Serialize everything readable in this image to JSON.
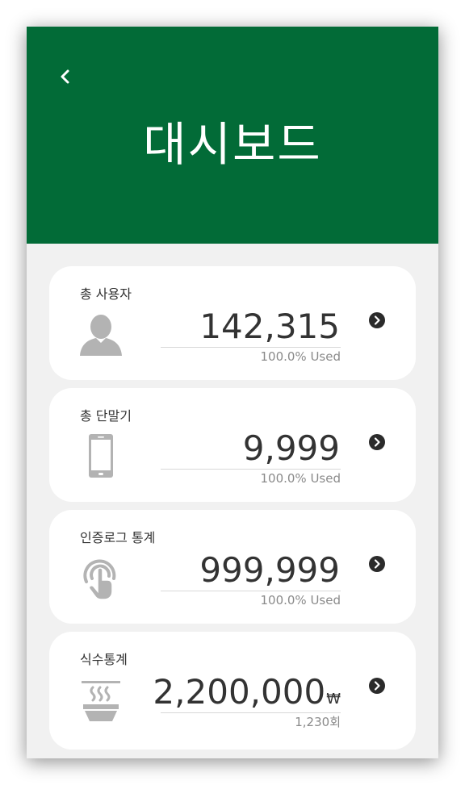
{
  "header": {
    "title": "대시보드",
    "back_icon": "chevron-left-icon",
    "background_color": "#026b37"
  },
  "cards": [
    {
      "title": "총 사용자",
      "value": "142,315",
      "currency": "",
      "sub": "100.0% Used",
      "icon": "user-icon"
    },
    {
      "title": "총 단말기",
      "value": "9,999",
      "currency": "",
      "sub": "100.0% Used",
      "icon": "smartphone-icon"
    },
    {
      "title": "인증로그 통계",
      "value": "999,999",
      "currency": "",
      "sub": "100.0% Used",
      "icon": "touch-icon"
    },
    {
      "title": "식수통계",
      "value": "2,200,000",
      "currency": "₩",
      "sub": "1,230회",
      "icon": "noodle-bowl-icon"
    }
  ]
}
